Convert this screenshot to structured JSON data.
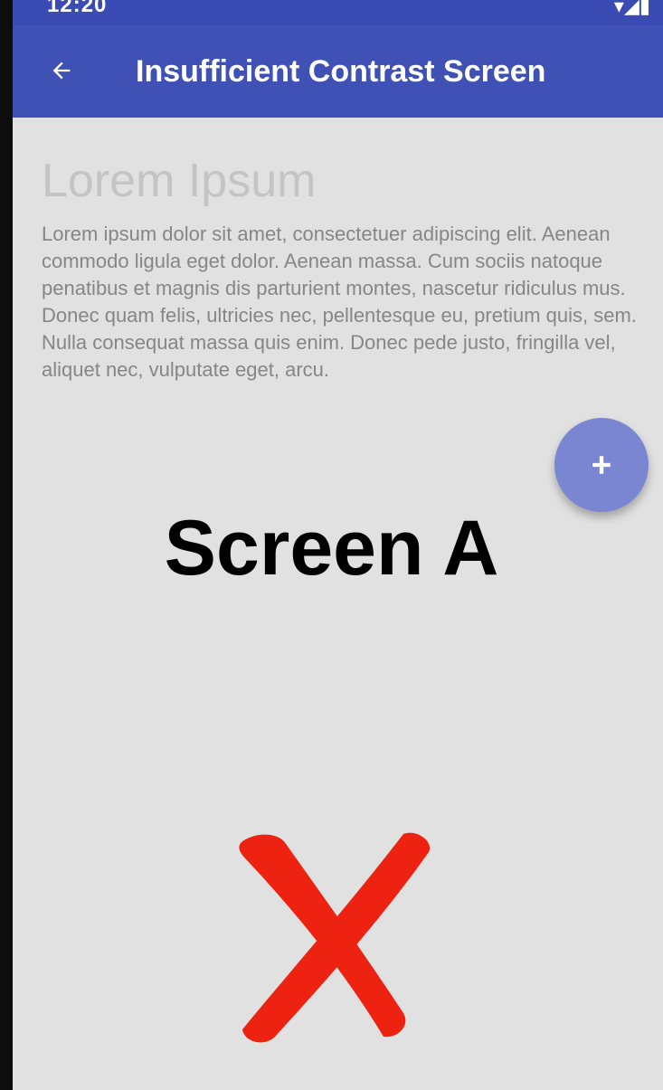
{
  "status_bar": {
    "time": "12:20",
    "icons": "▾◢▮"
  },
  "app_bar": {
    "back_icon": "arrow-left-icon",
    "title": "Insufficient Contrast Screen"
  },
  "content": {
    "heading": "Lorem Ipsum",
    "body": "Lorem ipsum dolor sit amet, consectetuer adipiscing elit. Aenean commodo ligula eget dolor. Aenean massa. Cum sociis natoque penatibus et magnis dis parturient montes, nascetur ridiculus mus. Donec quam felis, ultricies nec, pellentesque eu, pretium quis, sem. Nulla consequat massa quis enim. Donec pede justo, fringilla vel, aliquet nec, vulputate eget, arcu."
  },
  "fab": {
    "icon": "plus-icon"
  },
  "annotation": {
    "label": "Screen A",
    "mark_icon": "red-cross-icon"
  },
  "colors": {
    "app_bar": "#3f51b5",
    "status_bar": "#3a4cb3",
    "background": "#e1e1e1",
    "heading_text": "#c4c4c4",
    "body_text": "#868686",
    "fab": "#7b86d3",
    "cross": "#ee2211"
  }
}
